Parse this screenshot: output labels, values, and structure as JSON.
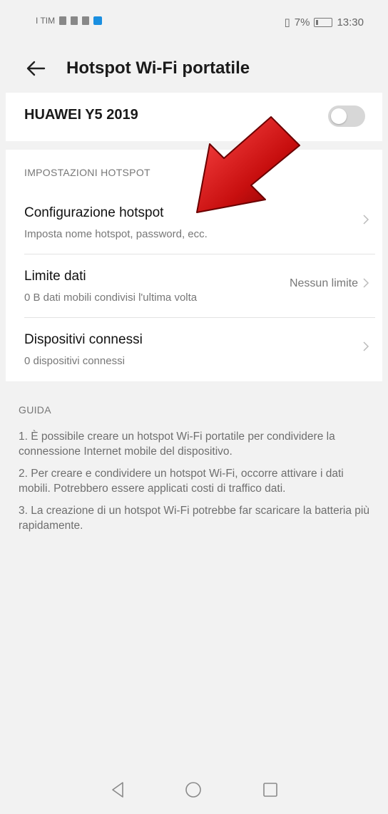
{
  "status_bar": {
    "left_text": "I TIM",
    "right_text": "7%",
    "time": "13:30"
  },
  "header": {
    "title": "Hotspot Wi-Fi portatile"
  },
  "device": {
    "name": "HUAWEI Y5 2019",
    "hotspot_enabled": false
  },
  "settings": {
    "section_title": "IMPOSTAZIONI HOTSPOT",
    "items": [
      {
        "title": "Configurazione hotspot",
        "subtitle": "Imposta nome hotspot, password, ecc.",
        "value": ""
      },
      {
        "title": "Limite dati",
        "subtitle": "0 B dati mobili condivisi l'ultima volta",
        "value": "Nessun limite"
      },
      {
        "title": "Dispositivi connessi",
        "subtitle": "0 dispositivi connessi",
        "value": ""
      }
    ]
  },
  "guide": {
    "title": "GUIDA",
    "paragraphs": [
      "1. È possibile creare un hotspot Wi-Fi portatile per condividere la connessione Internet mobile del dispositivo.",
      "2. Per creare e condividere un hotspot Wi-Fi, occorre attivare i dati mobili. Potrebbero essere applicati costi di traffico dati.",
      "3. La creazione di un hotspot Wi-Fi potrebbe far scaricare la batteria più rapidamente."
    ]
  },
  "nav": {
    "back_icon": "triangle-back-icon",
    "home_icon": "circle-home-icon",
    "recents_icon": "square-recents-icon"
  },
  "colors": {
    "background": "#f2f2f2",
    "card": "#ffffff",
    "annotation_arrow": "#cc1111"
  }
}
